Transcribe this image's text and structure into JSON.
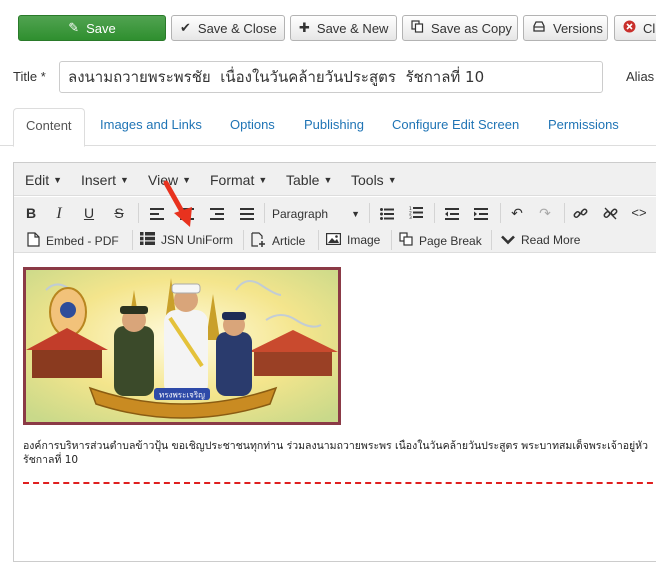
{
  "toolbar": {
    "save": "Save",
    "save_close": "Save & Close",
    "save_new": "Save & New",
    "save_copy": "Save as Copy",
    "versions": "Versions",
    "close": "Cl"
  },
  "title": {
    "label": "Title *",
    "value": "ลงนามถวายพระพรชัย  เนื่องในวันคล้ายวันประสูตร  รัชกาลที่ 10",
    "alias_label": "Alias"
  },
  "tabs": [
    "Content",
    "Images and Links",
    "Options",
    "Publishing",
    "Configure Edit Screen",
    "Permissions"
  ],
  "editor": {
    "menus": [
      "Edit",
      "Insert",
      "View",
      "Format",
      "Table",
      "Tools"
    ],
    "paragraph_select": "Paragraph",
    "buttons": {
      "embed_pdf": "Embed - PDF",
      "jsn_uniform": "JSN UniForm",
      "article": "Article",
      "image": "Image",
      "page_break": "Page Break",
      "read_more": "Read More"
    },
    "banner_caption": "ทรงพระเจริญ",
    "paragraph_line1": "องค์การบริหารส่วนตำบลข้าวปุ้น  ขอเชิญประชาชนทุกท่าน ร่วมลงนามถวายพระพร  เนื่องในวันคล้ายวันประสูตร  พระบาทสมเด็จพระเจ้าอยู่หัว",
    "paragraph_line2": "รัชกาลที่ 10"
  },
  "colors": {
    "save_green": "#3d9b3d",
    "link_blue": "#1f74b5",
    "annotation_red": "#e8321e",
    "dashed_red": "#e01f1f",
    "banner_frame": "#8b3a46"
  }
}
